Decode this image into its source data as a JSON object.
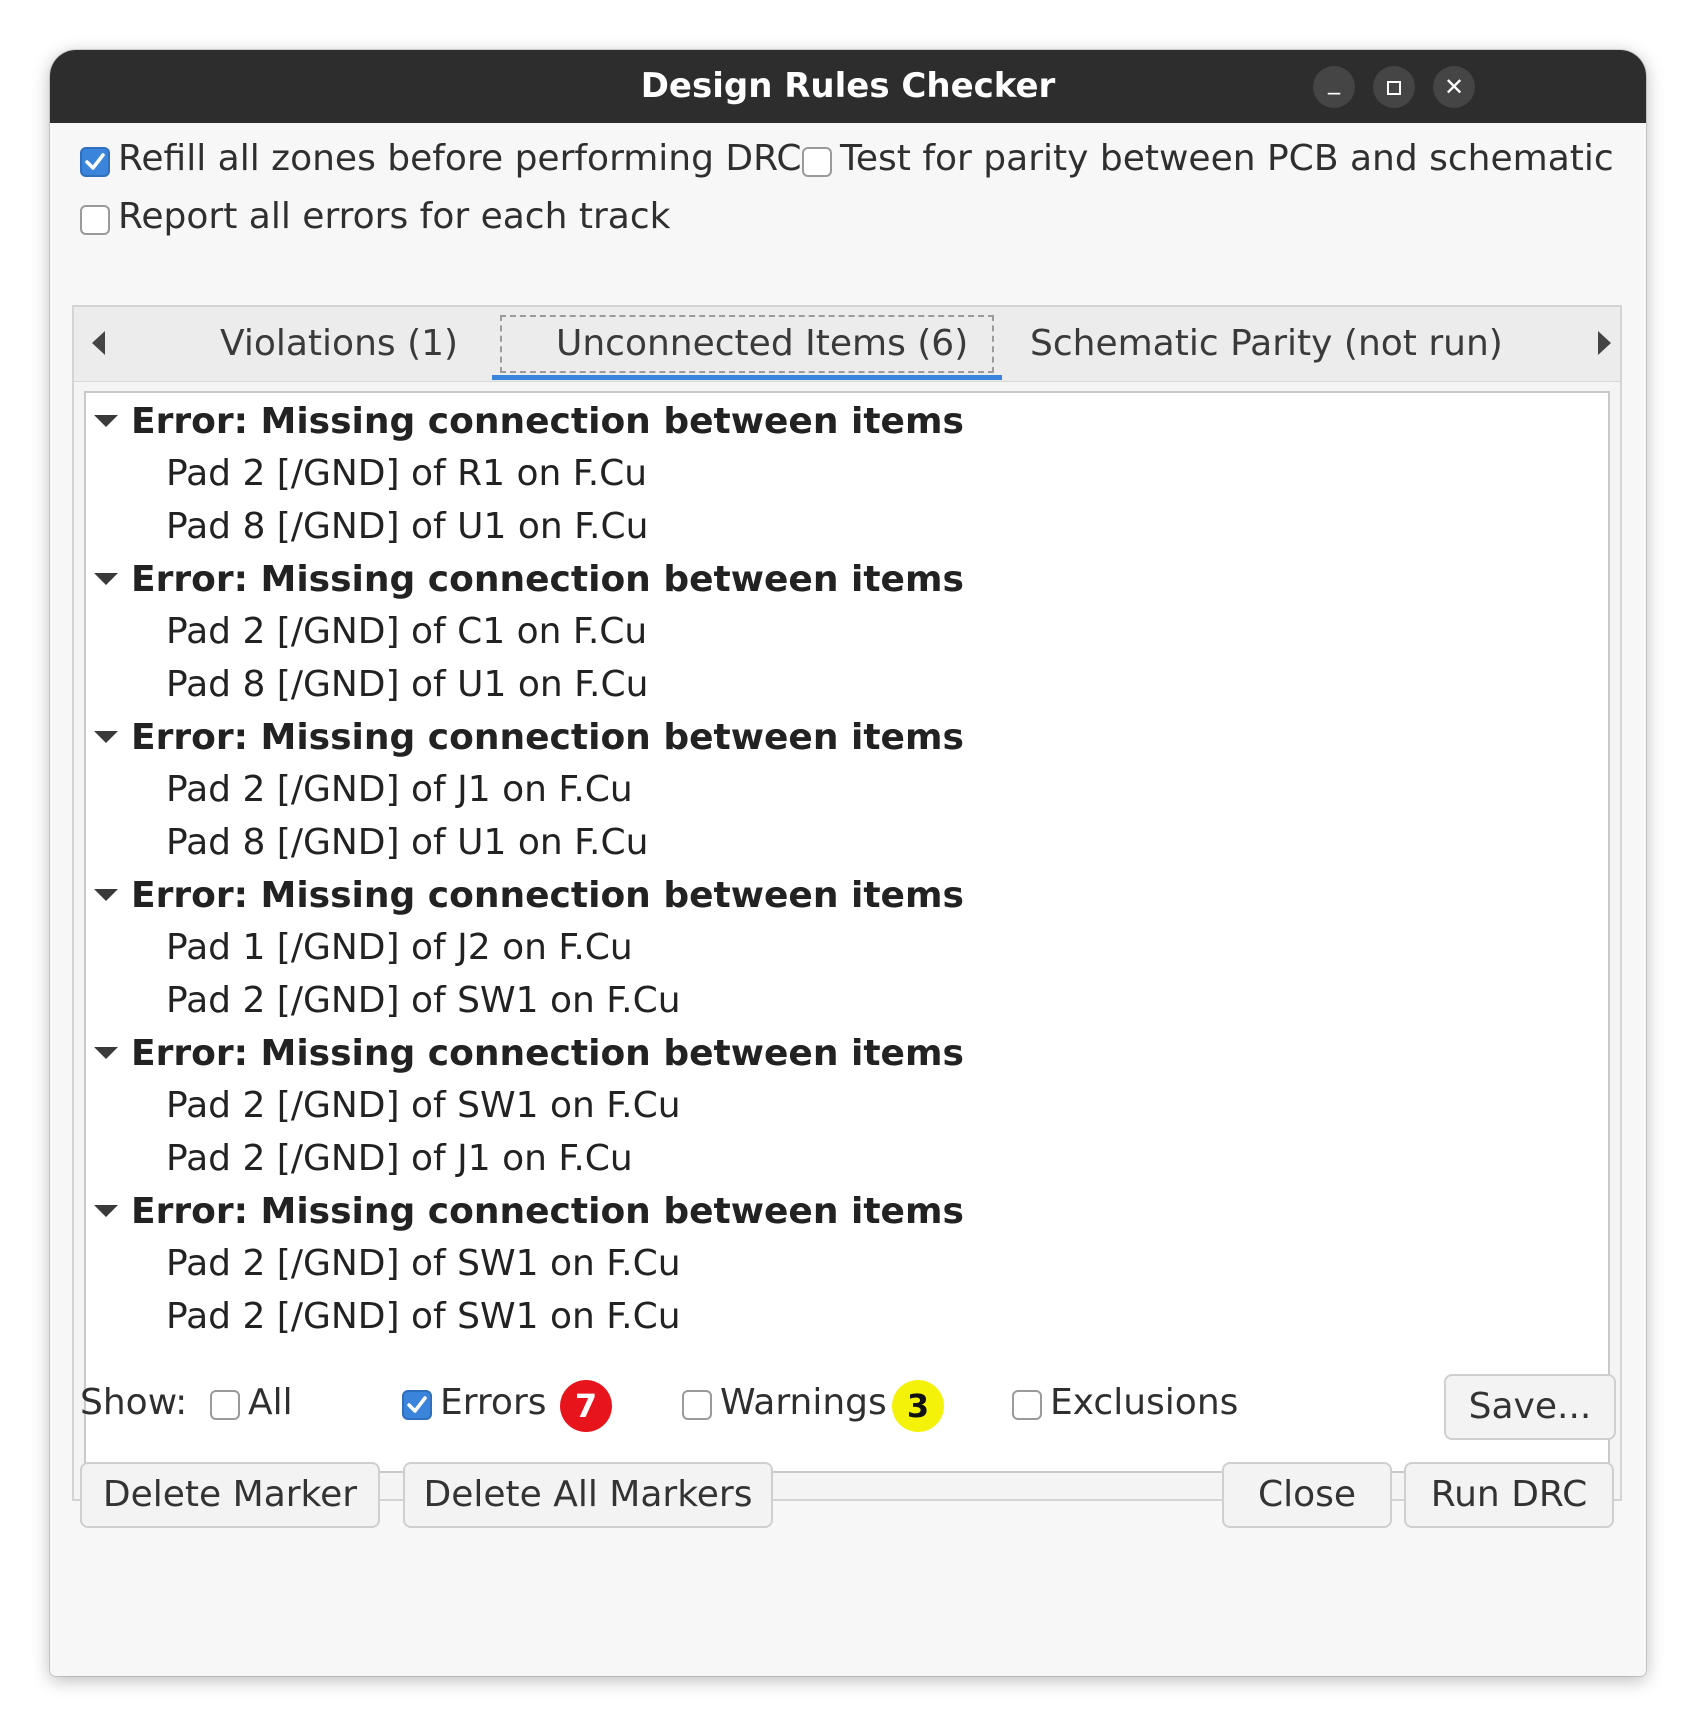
{
  "window": {
    "title": "Design Rules Checker"
  },
  "options": {
    "refill_zones": {
      "label": "Refill all zones before performing DRC",
      "checked": true
    },
    "test_parity": {
      "label": "Test for parity between PCB and schematic",
      "checked": false
    },
    "report_all_errors": {
      "label": "Report all errors for each track",
      "checked": false
    }
  },
  "tabs": [
    {
      "label": "Violations (1)",
      "active": false
    },
    {
      "label": "Unconnected Items (6)",
      "active": true
    },
    {
      "label": "Schematic Parity (not run)",
      "active": false
    }
  ],
  "groups": [
    {
      "title": "Error: Missing connection between items",
      "items": [
        "Pad 2 [/GND] of R1 on F.Cu",
        "Pad 8 [/GND] of U1 on F.Cu"
      ]
    },
    {
      "title": "Error: Missing connection between items",
      "items": [
        "Pad 2 [/GND] of C1 on F.Cu",
        "Pad 8 [/GND] of U1 on F.Cu"
      ]
    },
    {
      "title": "Error: Missing connection between items",
      "items": [
        "Pad 2 [/GND] of J1 on F.Cu",
        "Pad 8 [/GND] of U1 on F.Cu"
      ]
    },
    {
      "title": "Error: Missing connection between items",
      "items": [
        "Pad 1 [/GND] of J2 on F.Cu",
        "Pad 2 [/GND] of SW1 on F.Cu"
      ]
    },
    {
      "title": "Error: Missing connection between items",
      "items": [
        "Pad 2 [/GND] of SW1 on F.Cu",
        "Pad 2 [/GND] of J1 on F.Cu"
      ]
    },
    {
      "title": "Error: Missing connection between items",
      "items": [
        "Pad 2 [/GND] of SW1 on F.Cu",
        "Pad 2 [/GND] of SW1 on F.Cu"
      ]
    }
  ],
  "filters": {
    "show_label": "Show:",
    "all": {
      "label": "All",
      "checked": false
    },
    "errors": {
      "label": "Errors",
      "checked": true,
      "count": "7",
      "badge_color": "#e8141b"
    },
    "warnings": {
      "label": "Warnings",
      "checked": false,
      "count": "3",
      "badge_color": "#f5f20a"
    },
    "exclusions": {
      "label": "Exclusions",
      "checked": false
    }
  },
  "buttons": {
    "save": "Save...",
    "delete_marker": "Delete Marker",
    "delete_all_markers": "Delete All Markers",
    "close": "Close",
    "run_drc": "Run DRC"
  },
  "colors": {
    "accent": "#3a85db",
    "titlebar": "#2d2d2d"
  }
}
